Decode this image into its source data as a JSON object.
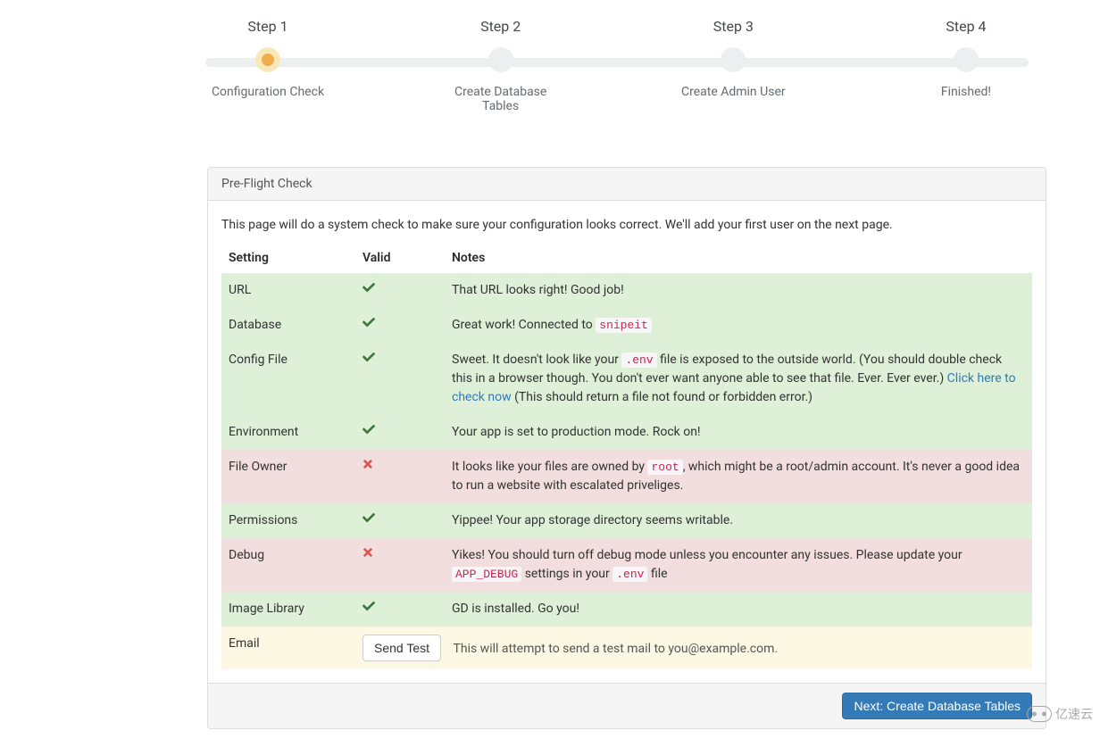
{
  "steps": [
    {
      "title": "Step 1",
      "sub": "Configuration Check"
    },
    {
      "title": "Step 2",
      "sub": "Create Database Tables"
    },
    {
      "title": "Step 3",
      "sub": "Create Admin User"
    },
    {
      "title": "Step 4",
      "sub": "Finished!"
    }
  ],
  "panel": {
    "heading": "Pre-Flight Check",
    "intro": "This page will do a system check to make sure your configuration looks correct. We'll add your first user on the next page.",
    "columns": {
      "setting": "Setting",
      "valid": "Valid",
      "notes": "Notes"
    }
  },
  "rows": {
    "url": {
      "setting": "URL",
      "notes": "That URL looks right! Good job!"
    },
    "database": {
      "setting": "Database",
      "notes_prefix": "Great work! Connected to ",
      "code": "snipeit"
    },
    "config": {
      "setting": "Config File",
      "notes_prefix": "Sweet. It doesn't look like your ",
      "code": ".env",
      "notes_mid": " file is exposed to the outside world. (You should double check this in a browser though. You don't ever want anyone able to see that file. Ever. Ever ever.) ",
      "link": "Click here to check now",
      "notes_suffix": " (This should return a file not found or forbidden error.)"
    },
    "environment": {
      "setting": "Environment",
      "notes": "Your app is set to production mode. Rock on!"
    },
    "fileowner": {
      "setting": "File Owner",
      "notes_prefix": "It looks like your files are owned by ",
      "code": "root",
      "notes_suffix": ", which might be a root/admin account. It's never a good idea to run a website with escalated priveliges."
    },
    "permissions": {
      "setting": "Permissions",
      "notes": "Yippee! Your app storage directory seems writable."
    },
    "debug": {
      "setting": "Debug",
      "notes_prefix": "Yikes! You should turn off debug mode unless you encounter any issues. Please update your ",
      "code1": "APP_DEBUG",
      "notes_mid": " settings in your ",
      "code2": ".env",
      "notes_suffix": " file"
    },
    "imagelib": {
      "setting": "Image Library",
      "notes": "GD is installed. Go you!"
    },
    "email": {
      "setting": "Email",
      "button": "Send Test",
      "note": "This will attempt to send a test mail to you@example.com."
    }
  },
  "footer": {
    "next_button": "Next: Create Database Tables"
  },
  "watermark": "亿速云"
}
